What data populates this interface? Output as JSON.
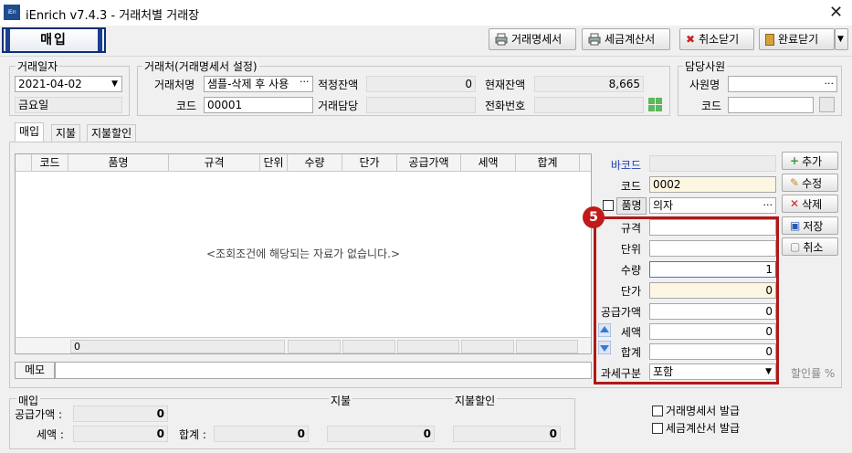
{
  "window": {
    "app_badge": "iEn",
    "title": "iEnrich v7.4.3 - 거래처별 거래장",
    "close": "✕"
  },
  "mode": "매입",
  "toolbar": {
    "statement": "거래명세서",
    "invoice": "세금계산서",
    "cancel_close": "취소닫기",
    "done_close": "완료닫기"
  },
  "date_group": {
    "title": "거래일자",
    "date": "2021-04-02",
    "weekday": "금요일"
  },
  "vendor": {
    "title": "거래처(거래명세서 설정)",
    "name_label": "거래처명",
    "name": "샘플-삭제 후 사용",
    "code_label": "코드",
    "code": "00001",
    "proper_balance_label": "적정잔액",
    "proper_balance": "0",
    "current_balance_label": "현재잔액",
    "current_balance": "8,665",
    "contact_label": "거래담당",
    "contact": "",
    "phone_label": "전화번호",
    "phone": ""
  },
  "staff": {
    "title": "담당사원",
    "name_label": "사원명",
    "name": "",
    "code_label": "코드",
    "code": ""
  },
  "tabs": [
    "매입",
    "지불",
    "지불할인"
  ],
  "grid": {
    "columns": [
      "코드",
      "품명",
      "규격",
      "단위",
      "수량",
      "단가",
      "공급가액",
      "세액",
      "합계"
    ],
    "empty_message": "<조회조건에 해당되는 자료가 없습니다.>",
    "footer_count": "0"
  },
  "memo_label": "메모",
  "form": {
    "barcode_label": "바코드",
    "barcode": "",
    "code_label": "코드",
    "code": "0002",
    "item_label": "품명",
    "item": "의자",
    "spec_label": "규격",
    "spec": "",
    "unit_label": "단위",
    "unit": "",
    "qty_label": "수량",
    "qty": "1",
    "price_label": "단가",
    "price": "0",
    "supply_label": "공급가액",
    "supply": "0",
    "tax_label": "세액",
    "tax": "0",
    "total_label": "합계",
    "total": "0",
    "tax_type_label": "과세구분",
    "tax_type": "포함",
    "discount_rate_label": "할인률 %"
  },
  "badge_number": "5",
  "side_buttons": [
    "추가",
    "수정",
    "삭제",
    "저장",
    "취소"
  ],
  "summary": {
    "purchase_title": "매입",
    "supply_label": "공급가액 :",
    "supply": "0",
    "tax_label": "세액 :",
    "tax": "0",
    "total_label": "합계 :",
    "total": "0",
    "payment_title": "지불",
    "payment": "0",
    "discount_title": "지불할인",
    "discount": "0"
  },
  "issue": {
    "statement": "거래명세서 발급",
    "invoice": "세금계산서 발급"
  }
}
